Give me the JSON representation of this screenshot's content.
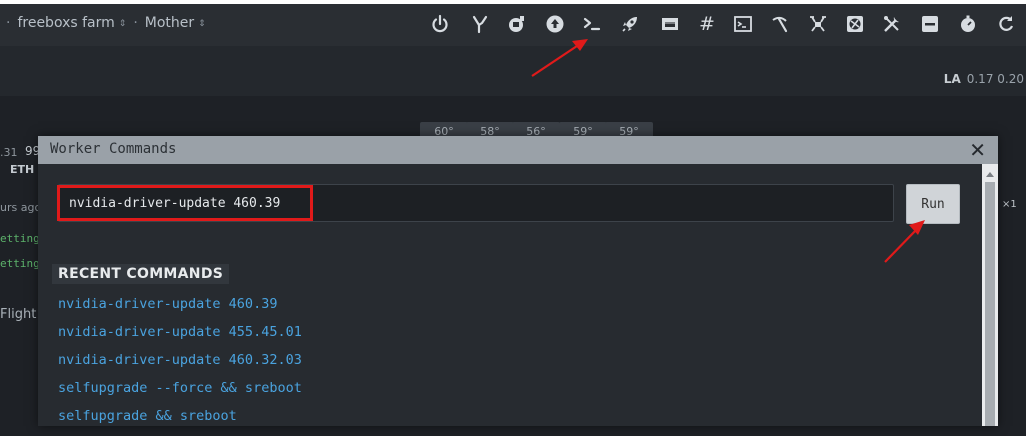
{
  "breadcrumb": {
    "farm": "freeboxs farm",
    "worker": "Mother"
  },
  "toolbar": {
    "icons": [
      "power-icon",
      "overclock-icon",
      "miner-icon",
      "upgrade-icon",
      "terminal-icon",
      "rocket-icon",
      "network-card-icon",
      "hash-icon",
      "console-icon",
      "pickaxe-icon",
      "asic-icon",
      "fan-icon",
      "tools-icon",
      "minus-icon",
      "timer-icon",
      "refresh-icon"
    ],
    "hash_symbol": "#"
  },
  "stats": {
    "la_label": "LA",
    "la_values": "0.17 0.20"
  },
  "background": {
    "temps": [
      "60°",
      "58°",
      "56°",
      "59°",
      "59°"
    ],
    "left_snippets": [
      ".31",
      "99",
      "ETH",
      "urs ago",
      "etting",
      "etting",
      "Flight"
    ],
    "right_snippet": "×1"
  },
  "modal": {
    "title": "Worker Commands",
    "close": "✕",
    "input_value": "nvidia-driver-update 460.39",
    "run_label": "Run",
    "recent_heading": "RECENT COMMANDS",
    "recent_commands": [
      "nvidia-driver-update 460.39",
      "nvidia-driver-update 455.45.01",
      "nvidia-driver-update 460.32.03",
      "selfupgrade --force && sreboot",
      "selfupgrade && sreboot"
    ]
  },
  "colors": {
    "accent_link": "#4aa3df",
    "annotation_red": "#e01a1a",
    "header_gray": "#9aa1a8"
  }
}
